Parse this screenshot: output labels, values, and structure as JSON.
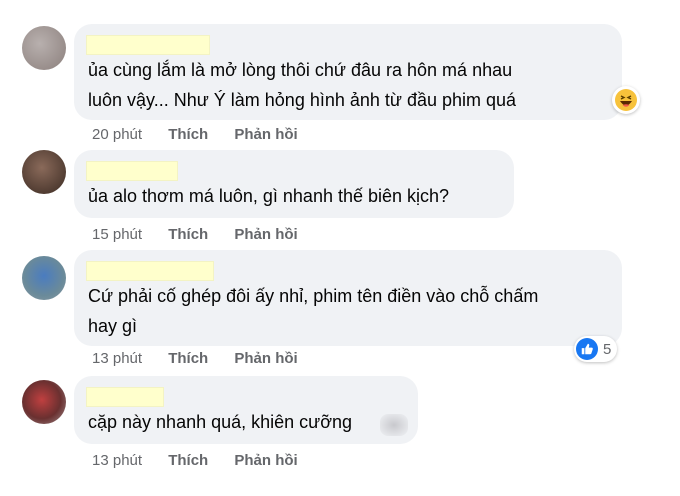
{
  "comments": [
    {
      "text": "ủa cùng lắm là mở lòng thôi chứ đâu ra hôn má nhau\nluôn vậy... Như Ý làm hỏng hình ảnh từ đầu phim quá",
      "time": "20 phút",
      "like": "Thích",
      "reply": "Phản hồi",
      "reaction": "haha-icon"
    },
    {
      "text": "ủa alo thơm má luôn, gì nhanh thế biên kịch?",
      "time": "15 phút",
      "like": "Thích",
      "reply": "Phản hồi"
    },
    {
      "text": "Cứ phải cố ghép đôi ấy nhỉ, phim tên điền vào chỗ chấm\nhay gì",
      "time": "13 phút",
      "like": "Thích",
      "reply": "Phản hồi",
      "reaction": "like-icon",
      "reaction_count": "5"
    },
    {
      "text": "cặp này nhanh quá, khiên cưỡng",
      "time": "13 phút",
      "like": "Thích",
      "reply": "Phản hồi"
    }
  ],
  "colors": {
    "bubble": "#f0f2f5",
    "meta_text": "#65676b",
    "like_blue": "#1877f2",
    "name_redaction": "#ffffcc"
  }
}
